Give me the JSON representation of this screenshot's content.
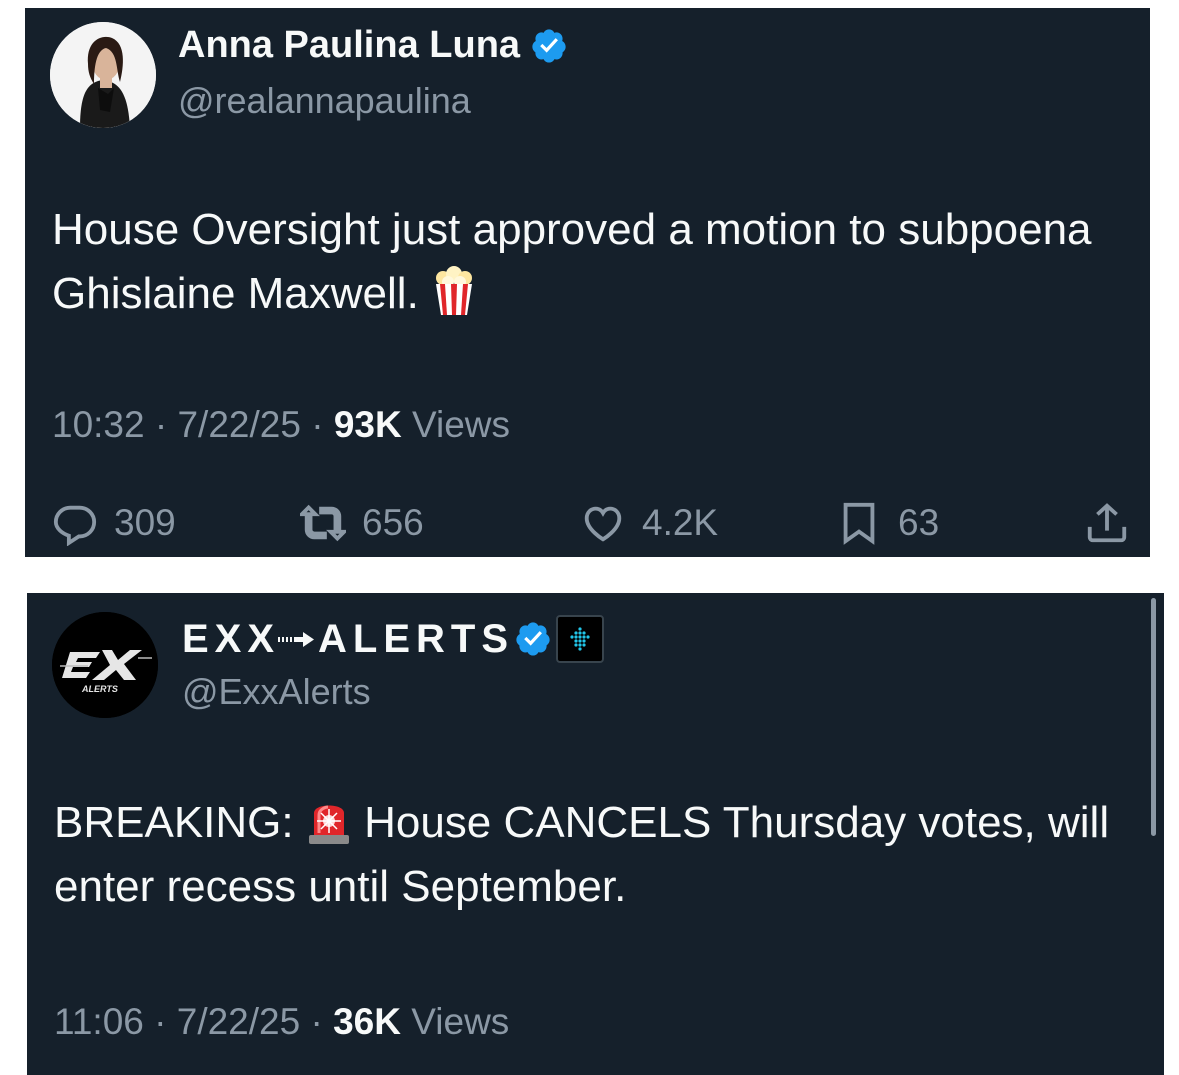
{
  "tweets": [
    {
      "display_name": "Anna Paulina Luna",
      "handle": "@realannapaulina",
      "verified": true,
      "text_before_emoji": "House Oversight just approved a motion to subpoena Ghislaine Maxwell. ",
      "emoji": "popcorn-emoji",
      "time": "10:32",
      "date": "7/22/25",
      "views_count": "93K",
      "views_label": "Views",
      "separator": "·",
      "actions": {
        "replies": "309",
        "reposts": "656",
        "likes": "4.2K",
        "bookmarks": "63"
      }
    },
    {
      "display_name_left": "EXX",
      "display_name_right": "ALERTS",
      "handle": "@ExxAlerts",
      "verified": true,
      "avatar_text": "ALERTS",
      "text_before_emoji": "BREAKING: ",
      "emoji": "police-light-emoji",
      "text_after_emoji": " House CANCELS Thursday votes, will enter recess until September.",
      "time": "11:06",
      "date": "7/22/25",
      "views_count": "36K",
      "views_label": "Views",
      "separator": "·"
    }
  ],
  "colors": {
    "background": "#15202b",
    "text": "#f7f9f9",
    "secondary": "#8b98a5",
    "verified": "#1d9bf0"
  }
}
